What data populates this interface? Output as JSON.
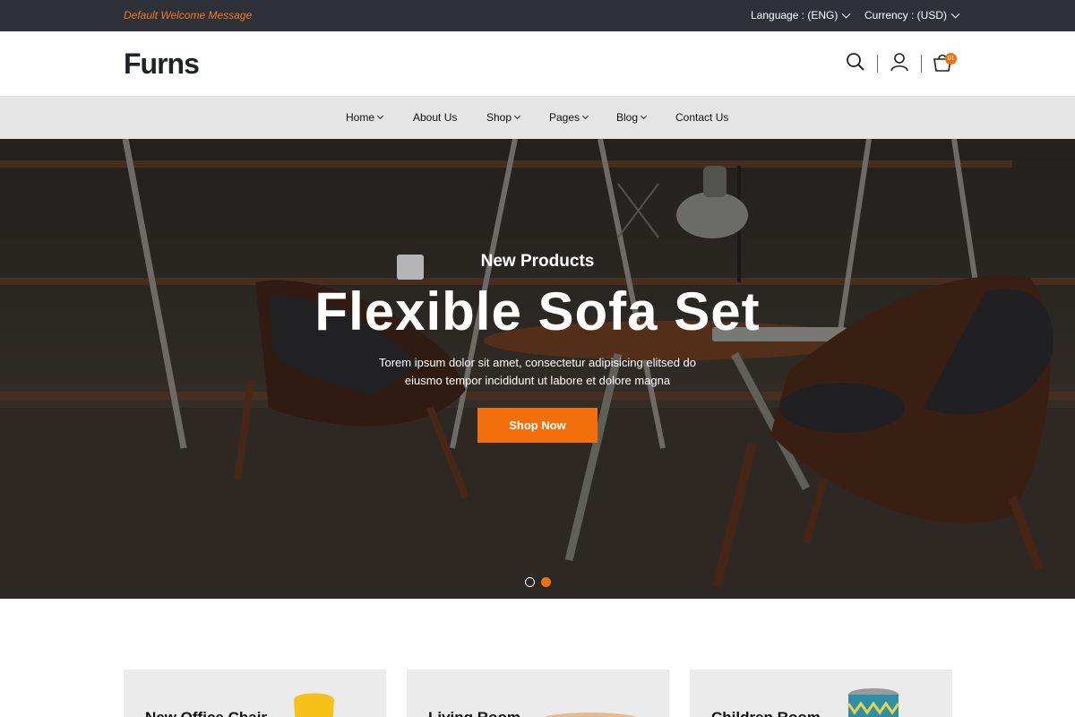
{
  "topbar": {
    "welcome": "Default Welcome Message",
    "language": "Language : (ENG)",
    "currency": "Currency : (USD)"
  },
  "header": {
    "logo": "Furns",
    "cart_count": "01"
  },
  "nav": {
    "items": [
      {
        "label": "Home",
        "dropdown": true
      },
      {
        "label": "About Us",
        "dropdown": false
      },
      {
        "label": "Shop",
        "dropdown": true
      },
      {
        "label": "Pages",
        "dropdown": true
      },
      {
        "label": "Blog",
        "dropdown": true
      },
      {
        "label": "Contact Us",
        "dropdown": false
      }
    ]
  },
  "hero": {
    "subtitle": "New Products",
    "title": "Flexible Sofa Set",
    "description_line1": "Torem ipsum dolor sit amet, consectetur adipisicing elitsed do",
    "description_line2": "eiusmo tempor incididunt ut labore et dolore magna",
    "button": "Shop Now",
    "active_slide": 2,
    "slides": 2
  },
  "categories": [
    {
      "title": "New Office Chair"
    },
    {
      "title": "Living Room"
    },
    {
      "title": "Children Room"
    }
  ],
  "colors": {
    "accent": "#f36f0c",
    "topbar": "#2e3138",
    "nav_bg": "#e5e5e5"
  },
  "icons": [
    "search-icon",
    "user-icon",
    "cart-icon",
    "chevron-down-icon"
  ]
}
